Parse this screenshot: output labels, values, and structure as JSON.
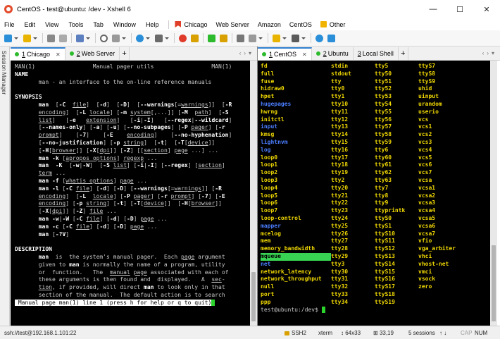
{
  "window": {
    "title": "CentOS - test@ubuntu: /dev - Xshell 6"
  },
  "window_buttons": {
    "minimize": "—",
    "maximize": "☐",
    "close": "✕"
  },
  "menu": {
    "items": [
      "File",
      "Edit",
      "View",
      "Tools",
      "Tab",
      "Window",
      "Help"
    ]
  },
  "bookmarks": [
    {
      "label": "Chicago",
      "color": "#e0402a"
    },
    {
      "label": "Web Server",
      "color": ""
    },
    {
      "label": "Amazon",
      "color": ""
    },
    {
      "label": "CentOS",
      "color": ""
    },
    {
      "label": "Other",
      "color": "#f0b400"
    }
  ],
  "sidebar": {
    "label": "Session Manager"
  },
  "left_tabs": [
    {
      "num": "1",
      "label": "Chicago",
      "active": true
    },
    {
      "num": "2",
      "label": "Web Server",
      "active": false
    }
  ],
  "right_tabs": [
    {
      "num": "1",
      "label": "CentOS",
      "active": true
    },
    {
      "num": "2",
      "label": "Ubuntu",
      "active": false
    },
    {
      "num": "3",
      "label": "Local Shell",
      "active": false
    }
  ],
  "left_terminal": {
    "header_left": "MAN(1)",
    "header_center": "Manual pager utils",
    "header_right": "MAN(1)",
    "status_line": " Manual page man(1) line 1 (press h for help or q to quit)"
  },
  "right_terminal": {
    "columns": [
      [
        "fd",
        "full",
        "fuse",
        "hidraw0",
        "hpet",
        "hugepages",
        "hwrng",
        "initctl",
        "input",
        "kmsg",
        "lightnvm",
        "log",
        "loop0",
        "loop1",
        "loop2",
        "loop3",
        "loop4",
        "loop5",
        "loop6",
        "loop7",
        "loop-control",
        "mapper",
        "mcelog",
        "mem",
        "memory_bandwidth",
        "mqueue",
        "net",
        "network_latency",
        "network_throughput",
        "null",
        "port",
        "ppp"
      ],
      [
        "stdin",
        "stdout",
        "tty",
        "tty0",
        "tty1",
        "tty10",
        "tty11",
        "tty12",
        "tty13",
        "tty14",
        "tty15",
        "tty16",
        "tty17",
        "tty18",
        "tty19",
        "tty2",
        "tty20",
        "tty21",
        "tty22",
        "tty23",
        "tty24",
        "tty25",
        "tty26",
        "tty27",
        "tty28",
        "tty29",
        "tty3",
        "tty30",
        "tty31",
        "tty32",
        "tty33",
        "tty34"
      ],
      [
        "tty5",
        "tty50",
        "tty51",
        "tty52",
        "tty53",
        "tty54",
        "tty55",
        "tty56",
        "tty57",
        "tty58",
        "tty59",
        "tty6",
        "tty60",
        "tty61",
        "tty62",
        "tty63",
        "tty7",
        "tty8",
        "tty9",
        "ttyprintk",
        "ttyS0",
        "ttyS1",
        "ttyS10",
        "ttyS11",
        "ttyS12",
        "ttyS13",
        "ttyS14",
        "ttyS15",
        "ttyS16",
        "ttyS17",
        "ttyS18",
        "ttyS19"
      ],
      [
        "ttyS7",
        "ttyS8",
        "ttyS9",
        "uhid",
        "uinput",
        "urandom",
        "userio",
        "vcs",
        "vcs1",
        "vcs2",
        "vcs3",
        "vcs4",
        "vcs5",
        "vcs6",
        "vcs7",
        "vcsa",
        "vcsa1",
        "vcsa2",
        "vcsa3",
        "vcsa4",
        "vcsa5",
        "vcsa6",
        "vcsa7",
        "vfio",
        "vga_arbiter",
        "vhci",
        "vhost-net",
        "vmci",
        "vsock",
        "zero",
        "",
        ""
      ]
    ],
    "prompt": "test@ubuntu:/dev$ "
  },
  "statusbar": {
    "connection": "ssh://test@192.168.1.101:22",
    "protocol": "SSH2",
    "term": "xterm",
    "size": "64x33",
    "cursor": "33,19",
    "sessions": "5 sessions",
    "caps": "CAP",
    "num": "NUM"
  },
  "colors": {
    "accent": "#2e7fd0",
    "tab_dot": "#2dba2d",
    "dir_blue": "#4a7dff",
    "dev_yellow": "#f0d800",
    "green": "#39d353"
  },
  "icons": [
    "new-session-icon",
    "open-icon",
    "reconnect-icon",
    "properties-icon",
    "find-icon",
    "zoom-icon",
    "globe-icon",
    "script-icon",
    "xftp-icon",
    "xmanager-icon",
    "transfer-icon",
    "lock-icon",
    "keyboard-icon",
    "compose-icon",
    "layout-icon",
    "help-icon",
    "chat-icon"
  ]
}
